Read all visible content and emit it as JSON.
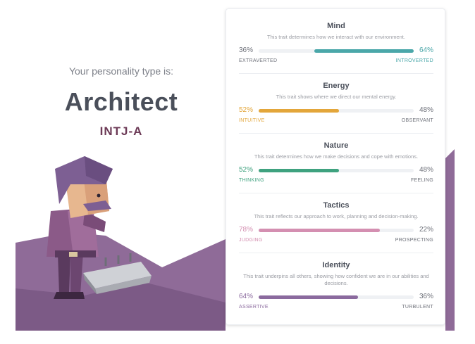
{
  "intro": "Your personality type is:",
  "type_name": "Architect",
  "type_code": "INTJ-A",
  "colors": {
    "mind": "#4aa7a9",
    "energy": "#e3a63a",
    "nature": "#3fa27f",
    "tactics": "#d48fb1",
    "identity": "#8b6a9e",
    "hill": "#8f6b98"
  },
  "traits": [
    {
      "title": "Mind",
      "description": "This trait determines how we interact with our environment.",
      "left_pct": "36%",
      "right_pct": "64%",
      "left_label": "EXTRAVERTED",
      "right_label": "INTROVERTED",
      "dominant": "right",
      "level": 0.64
    },
    {
      "title": "Energy",
      "description": "This trait shows where we direct our mental energy.",
      "left_pct": "52%",
      "right_pct": "48%",
      "left_label": "INTUITIVE",
      "right_label": "OBSERVANT",
      "dominant": "left",
      "level": 0.52
    },
    {
      "title": "Nature",
      "description": "This trait determines how we make decisions and cope with emotions.",
      "left_pct": "52%",
      "right_pct": "48%",
      "left_label": "THINKING",
      "right_label": "FEELING",
      "dominant": "left",
      "level": 0.52
    },
    {
      "title": "Tactics",
      "description": "This trait reflects our approach to work, planning and decision-making.",
      "left_pct": "78%",
      "right_pct": "22%",
      "left_label": "JUDGING",
      "right_label": "PROSPECTING",
      "dominant": "left",
      "level": 0.78
    },
    {
      "title": "Identity",
      "description": "This trait underpins all others, showing how confident we are in our abilities and decisions.",
      "left_pct": "64%",
      "right_pct": "36%",
      "left_label": "ASSERTIVE",
      "right_label": "TURBULENT",
      "dominant": "left",
      "level": 0.64
    }
  ]
}
